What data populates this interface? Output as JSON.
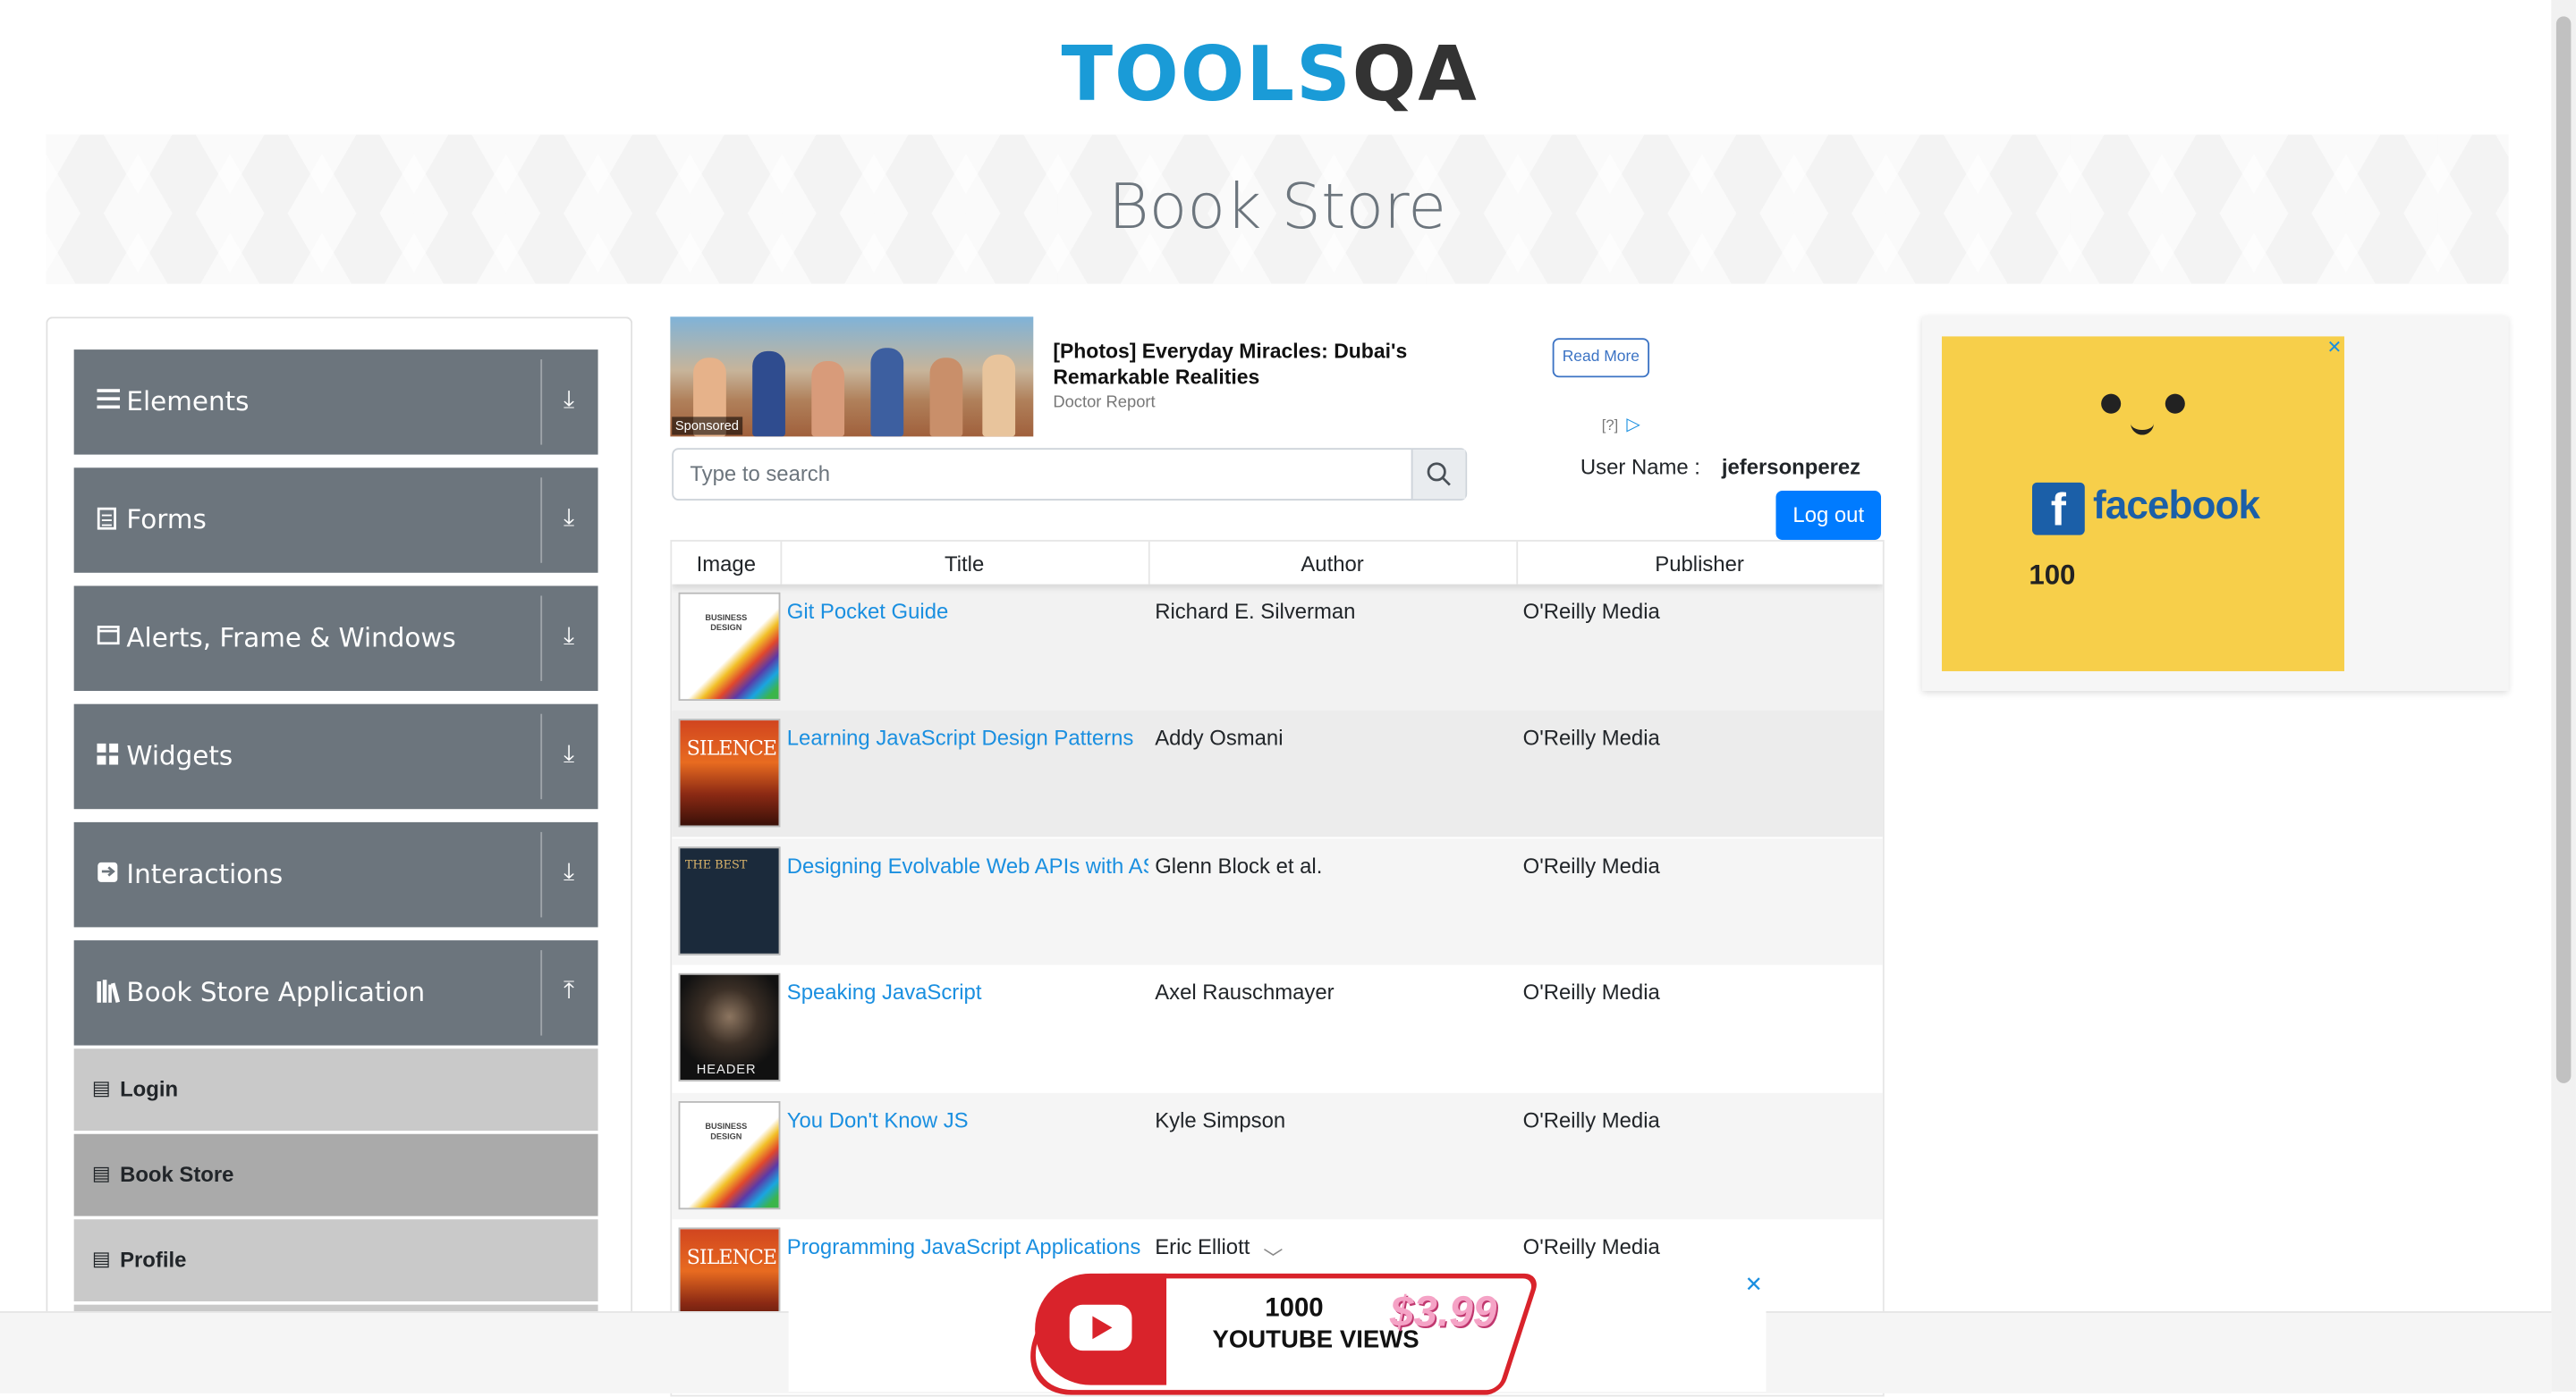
{
  "logo": {
    "part1": "TOOLS",
    "part2": "QA"
  },
  "banner": {
    "title": "Book Store"
  },
  "sidebar": {
    "groups": [
      {
        "label": "Elements",
        "icon": "hamburger-icon",
        "arrow": "download-icon"
      },
      {
        "label": "Forms",
        "icon": "document-icon",
        "arrow": "download-icon"
      },
      {
        "label": "Alerts, Frame & Windows",
        "icon": "window-icon",
        "arrow": "download-icon"
      },
      {
        "label": "Widgets",
        "icon": "grid-icon",
        "arrow": "download-icon"
      },
      {
        "label": "Interactions",
        "icon": "toggle-icon",
        "arrow": "download-icon"
      },
      {
        "label": "Book Store Application",
        "icon": "books-icon",
        "arrow": "upload-icon"
      }
    ],
    "subitems": [
      {
        "label": "Login"
      },
      {
        "label": "Book Store",
        "active": true
      },
      {
        "label": "Profile"
      }
    ]
  },
  "ad_top": {
    "sponsored": "Sponsored",
    "title": "[Photos] Everyday Miracles: Dubai's Remarkable Realities",
    "source": "Doctor Report",
    "button": "Read More",
    "info": "[?]"
  },
  "search": {
    "placeholder": "Type to search"
  },
  "user": {
    "label": "User Name :",
    "value": "jefersonperez",
    "logout": "Log out"
  },
  "table": {
    "headers": [
      "Image",
      "Title",
      "Author",
      "Publisher"
    ],
    "rows": [
      {
        "cover": "BUSINESS DESIGN",
        "title": "Git Pocket Guide",
        "author": "Richard E. Silverman",
        "publisher": "O'Reilly Media"
      },
      {
        "cover": "SILENCE",
        "title": "Learning JavaScript Design Patterns",
        "author": "Addy Osmani",
        "publisher": "O'Reilly Media"
      },
      {
        "cover": "THE BEST",
        "title": "Designing Evolvable Web APIs with ASP.NET",
        "author": "Glenn Block et al.",
        "publisher": "O'Reilly Media"
      },
      {
        "cover": "HEADER",
        "title": "Speaking JavaScript",
        "author": "Axel Rauschmayer",
        "publisher": "O'Reilly Media"
      },
      {
        "cover": "BUSINESS DESIGN",
        "title": "You Don't Know JS",
        "author": "Kyle Simpson",
        "publisher": "O'Reilly Media"
      },
      {
        "cover": "SILENCE",
        "title": "Programming JavaScript Applications",
        "author": "Eric Elliott",
        "publisher": "O'Reilly Media"
      }
    ]
  },
  "ad_right": {
    "brand": "facebook",
    "count": "100",
    "close": "✕"
  },
  "ad_bottom": {
    "line1": "1000",
    "line2": "YOUTUBE VIEWS",
    "price": "$3.99",
    "close": "✕"
  },
  "colors": {
    "accent": "#007bff",
    "sidebar": "#6c757d",
    "link": "#1a8fe0"
  }
}
